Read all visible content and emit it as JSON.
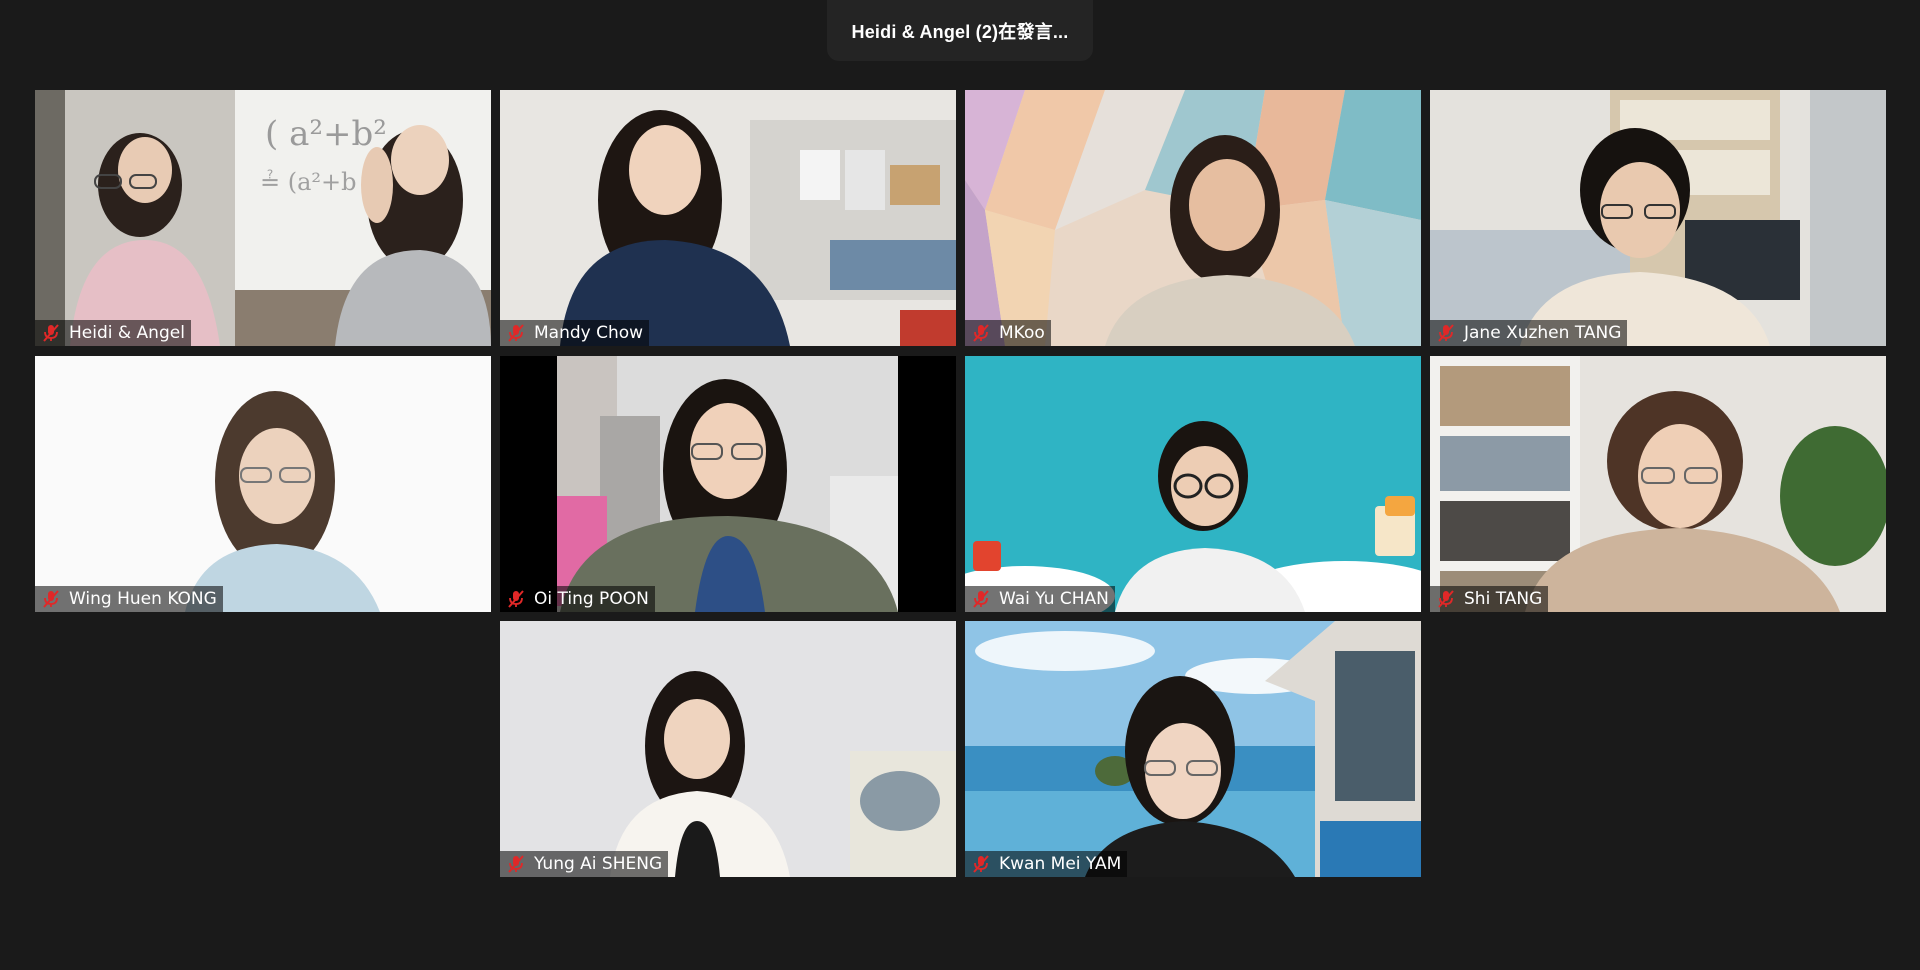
{
  "speaker_banner": "Heidi & Angel (2)在發言...",
  "participants": [
    {
      "name": "Heidi & Angel",
      "muted": true
    },
    {
      "name": "Mandy Chow",
      "muted": true
    },
    {
      "name": "MKoo",
      "muted": true
    },
    {
      "name": "Jane Xuzhen TANG",
      "muted": true
    },
    {
      "name": "Wing Huen KONG",
      "muted": true
    },
    {
      "name": "Oi Ting POON",
      "muted": true
    },
    {
      "name": "Wai Yu CHAN",
      "muted": true
    },
    {
      "name": "Shi TANG",
      "muted": true
    },
    {
      "name": "Yung Ai SHENG",
      "muted": true
    },
    {
      "name": "Kwan Mei YAM",
      "muted": true
    }
  ],
  "colors": {
    "background": "#1a1a1a",
    "muted_icon": "#e02828",
    "name_text": "#ffffff"
  },
  "icons": {
    "muted": "microphone-muted-icon"
  }
}
